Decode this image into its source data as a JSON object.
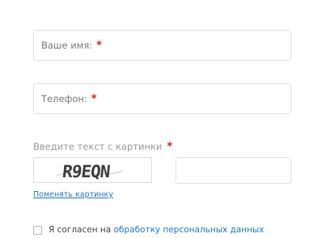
{
  "form": {
    "name_field": {
      "label": "Ваше имя:",
      "required_mark": "*",
      "value": ""
    },
    "phone_field": {
      "label": "Телефон:",
      "required_mark": "*",
      "value": ""
    },
    "captcha": {
      "label": "Введите текст с картинки",
      "required_mark": "*",
      "image_text": "R9EQN",
      "input_value": "",
      "change_link": "Поменять картинку"
    },
    "consent": {
      "text_prefix": "Я согласен на ",
      "link_text": "обработку персональных данных",
      "checked": false
    }
  },
  "colors": {
    "required": "#d21f1f",
    "link": "#2277bb",
    "border": "#e2e2e2"
  }
}
